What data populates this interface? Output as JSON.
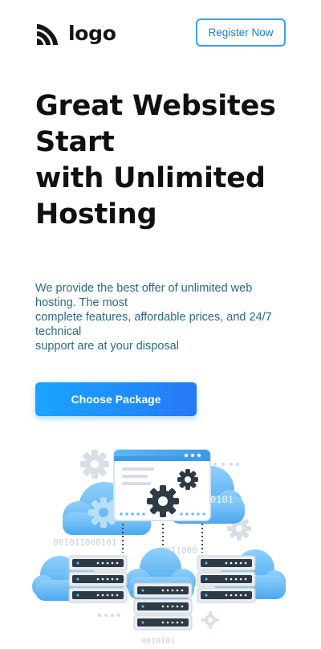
{
  "header": {
    "logo_text": "logo",
    "logo_icon": "signal-waves-icon",
    "register_label": "Register Now"
  },
  "hero": {
    "title_lines": [
      "Great Websites",
      "Start",
      "with Unlimited",
      "Hosting"
    ],
    "description_lines": [
      "We provide the best offer of unlimited web",
      "hosting. The most",
      "complete features, affordable prices, and 24/7",
      "technical",
      "support are at your disposal"
    ],
    "cta_label": "Choose Package"
  },
  "illustration": {
    "binary_left": "001011000101",
    "binary_right_top": "0101",
    "binary_right_mid": "011000",
    "binary_bottom": "0010101"
  },
  "colors": {
    "accent": "#1f8cfb",
    "cloud": "#5fb6f2",
    "text_dark": "#101010",
    "text_muted": "#2c6a86",
    "gear": "#2e3a45"
  }
}
